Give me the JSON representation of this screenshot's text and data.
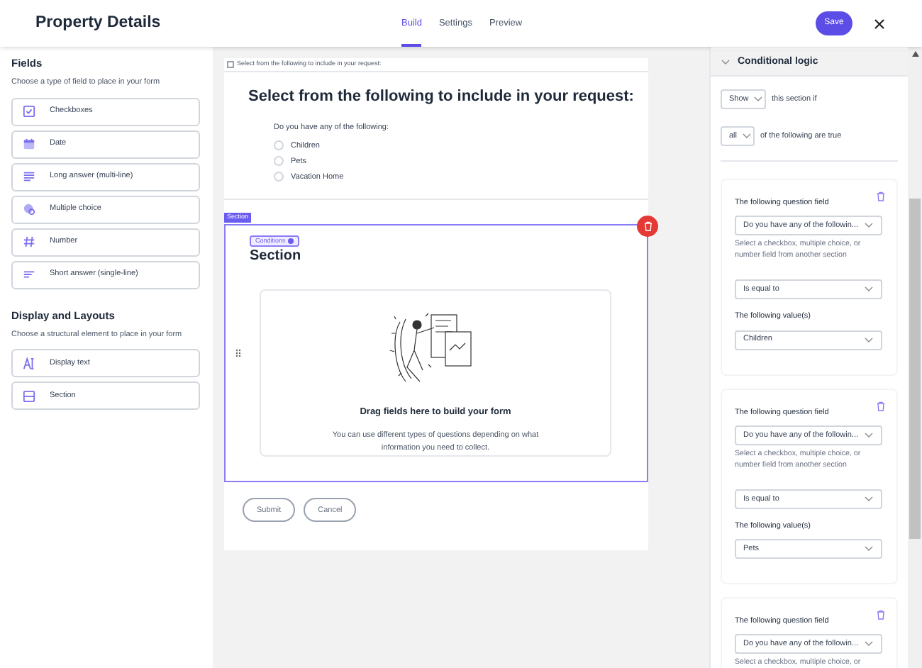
{
  "header": {
    "title": "Property Details",
    "tabs": [
      {
        "label": "Build",
        "selected": true
      },
      {
        "label": "Settings",
        "selected": false
      },
      {
        "label": "Preview",
        "selected": false
      }
    ],
    "save_button": "Save"
  },
  "sidebar": {
    "sections": [
      {
        "heading": "Fields",
        "description": "Choose a type of field to place in your form",
        "items": [
          {
            "kind": "checkbox",
            "label": "Checkboxes"
          },
          {
            "kind": "date",
            "label": "Date"
          },
          {
            "kind": "long",
            "label": "Long answer (multi-line)"
          },
          {
            "kind": "choice",
            "label": "Multiple choice"
          },
          {
            "kind": "number",
            "label": "Number"
          },
          {
            "kind": "short",
            "label": "Short answer (single-line)"
          }
        ]
      },
      {
        "heading": "Display and Layouts",
        "description": "Choose a structural element to place in your form",
        "items": [
          {
            "kind": "text",
            "label": "Display text"
          },
          {
            "kind": "section",
            "label": "Section"
          }
        ]
      }
    ]
  },
  "canvas": {
    "question_block": {
      "tag": "Select from the following to include in your request:",
      "heading": "Select from the following to include in your request:",
      "question": "Do you have any of the following:",
      "options": [
        {
          "label": "Children",
          "selected": false
        },
        {
          "label": "Pets",
          "selected": false
        },
        {
          "label": "Vacation Home",
          "selected": false
        }
      ]
    },
    "section_block": {
      "tag": "Section",
      "badge": "Conditions",
      "heading": "Section",
      "dropzone_title": "Drag fields here to build your form",
      "dropzone_text": "You can use different types of questions depending on what information you need to collect."
    },
    "buttons": [
      "Submit",
      "Cancel"
    ]
  },
  "logic_panel": {
    "title": "Conditional logic",
    "action": "Show",
    "action_text": "this section if",
    "match": "all",
    "match_text": "of the following are true",
    "conditions": [
      {
        "field_label": "The following question field",
        "field": "Do you have any of the followin...",
        "helper": "Select a checkbox, multiple choice, or number field from another section",
        "operator": "Is equal to",
        "values_label": "The following value(s)",
        "value": "Children"
      },
      {
        "field_label": "The following question field",
        "field": "Do you have any of the followin...",
        "helper": "Select a checkbox, multiple choice, or number field from another section",
        "operator": "Is equal to",
        "values_label": "The following value(s)",
        "value": "Pets"
      },
      {
        "field_label": "The following question field",
        "field": "Do you have any of the followin...",
        "helper": "Select a checkbox, multiple choice, or"
      }
    ]
  }
}
